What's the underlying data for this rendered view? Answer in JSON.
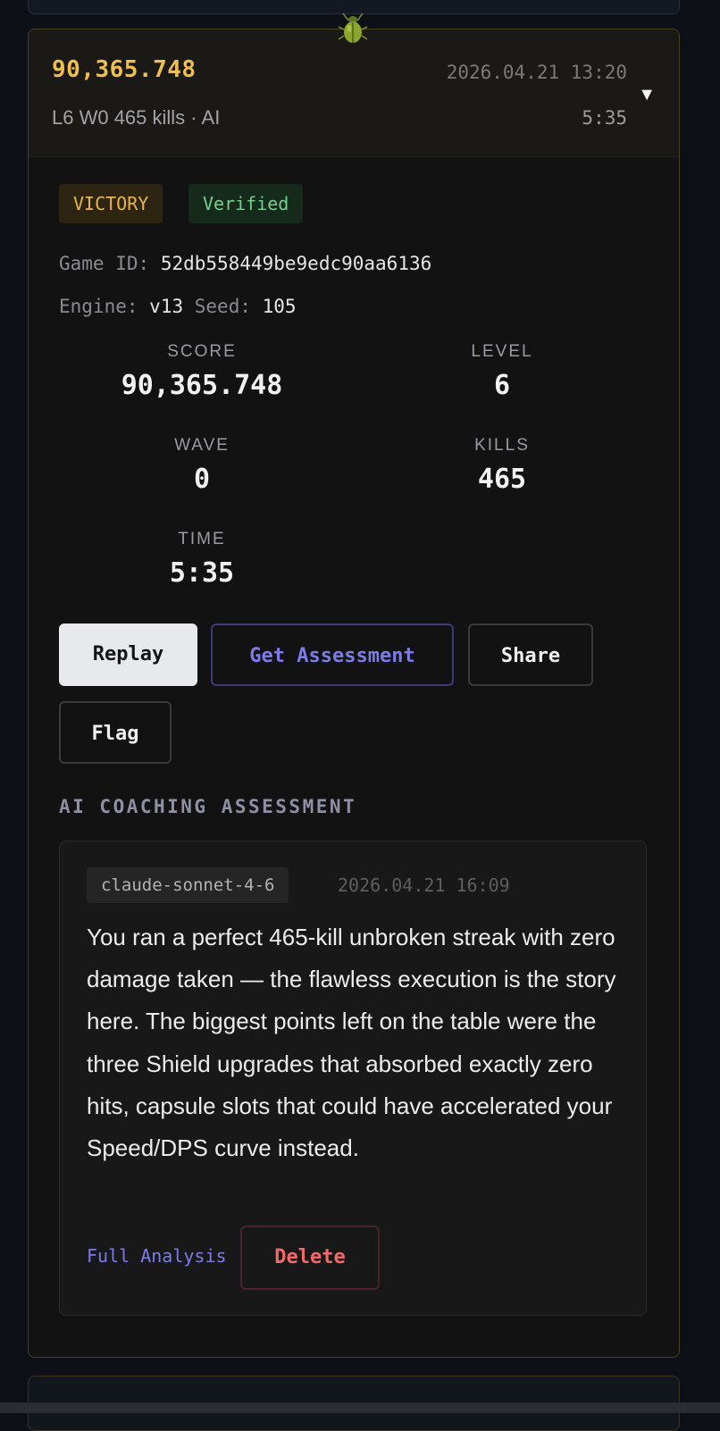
{
  "run": {
    "header_score": "90,365.748",
    "date": "2026.04.21 13:20",
    "summary": "L6 W0 465 kills · AI",
    "duration": "5:35",
    "badges": {
      "victory": "VICTORY",
      "verified": "Verified"
    },
    "game_id_label": "Game ID:",
    "game_id": "52db558449be9edc90aa6136",
    "engine_label": "Engine:",
    "engine": "v13",
    "seed_label": "Seed:",
    "seed": "105"
  },
  "stats": {
    "score": {
      "label": "SCORE",
      "value": "90,365.748"
    },
    "level": {
      "label": "LEVEL",
      "value": "6"
    },
    "wave": {
      "label": "WAVE",
      "value": "0"
    },
    "kills": {
      "label": "KILLS",
      "value": "465"
    },
    "time": {
      "label": "TIME",
      "value": "5:35"
    }
  },
  "actions": {
    "replay": "Replay",
    "assessment": "Get Assessment",
    "share": "Share",
    "flag": "Flag"
  },
  "coaching": {
    "section_title": "AI COACHING ASSESSMENT",
    "model": "claude-sonnet-4-6",
    "date": "2026.04.21 16:09",
    "text": "You ran a perfect 465-kill unbroken streak with zero damage taken — the flawless execution is the story here. The biggest points left on the table were the three Shield upgrades that absorbed exactly zero hits, capsule slots that could have accelerated your Speed/DPS curve instead.",
    "full_link": "Full Analysis",
    "delete": "Delete"
  },
  "icons": {
    "bug": "bug-icon",
    "caret": "caret-down-icon"
  },
  "colors": {
    "accent_gold": "#f0bd4f",
    "accent_indigo": "#7c7ce8",
    "success_green": "#74cf8c",
    "danger_red": "#ef6b67",
    "background": "#0d1017"
  }
}
